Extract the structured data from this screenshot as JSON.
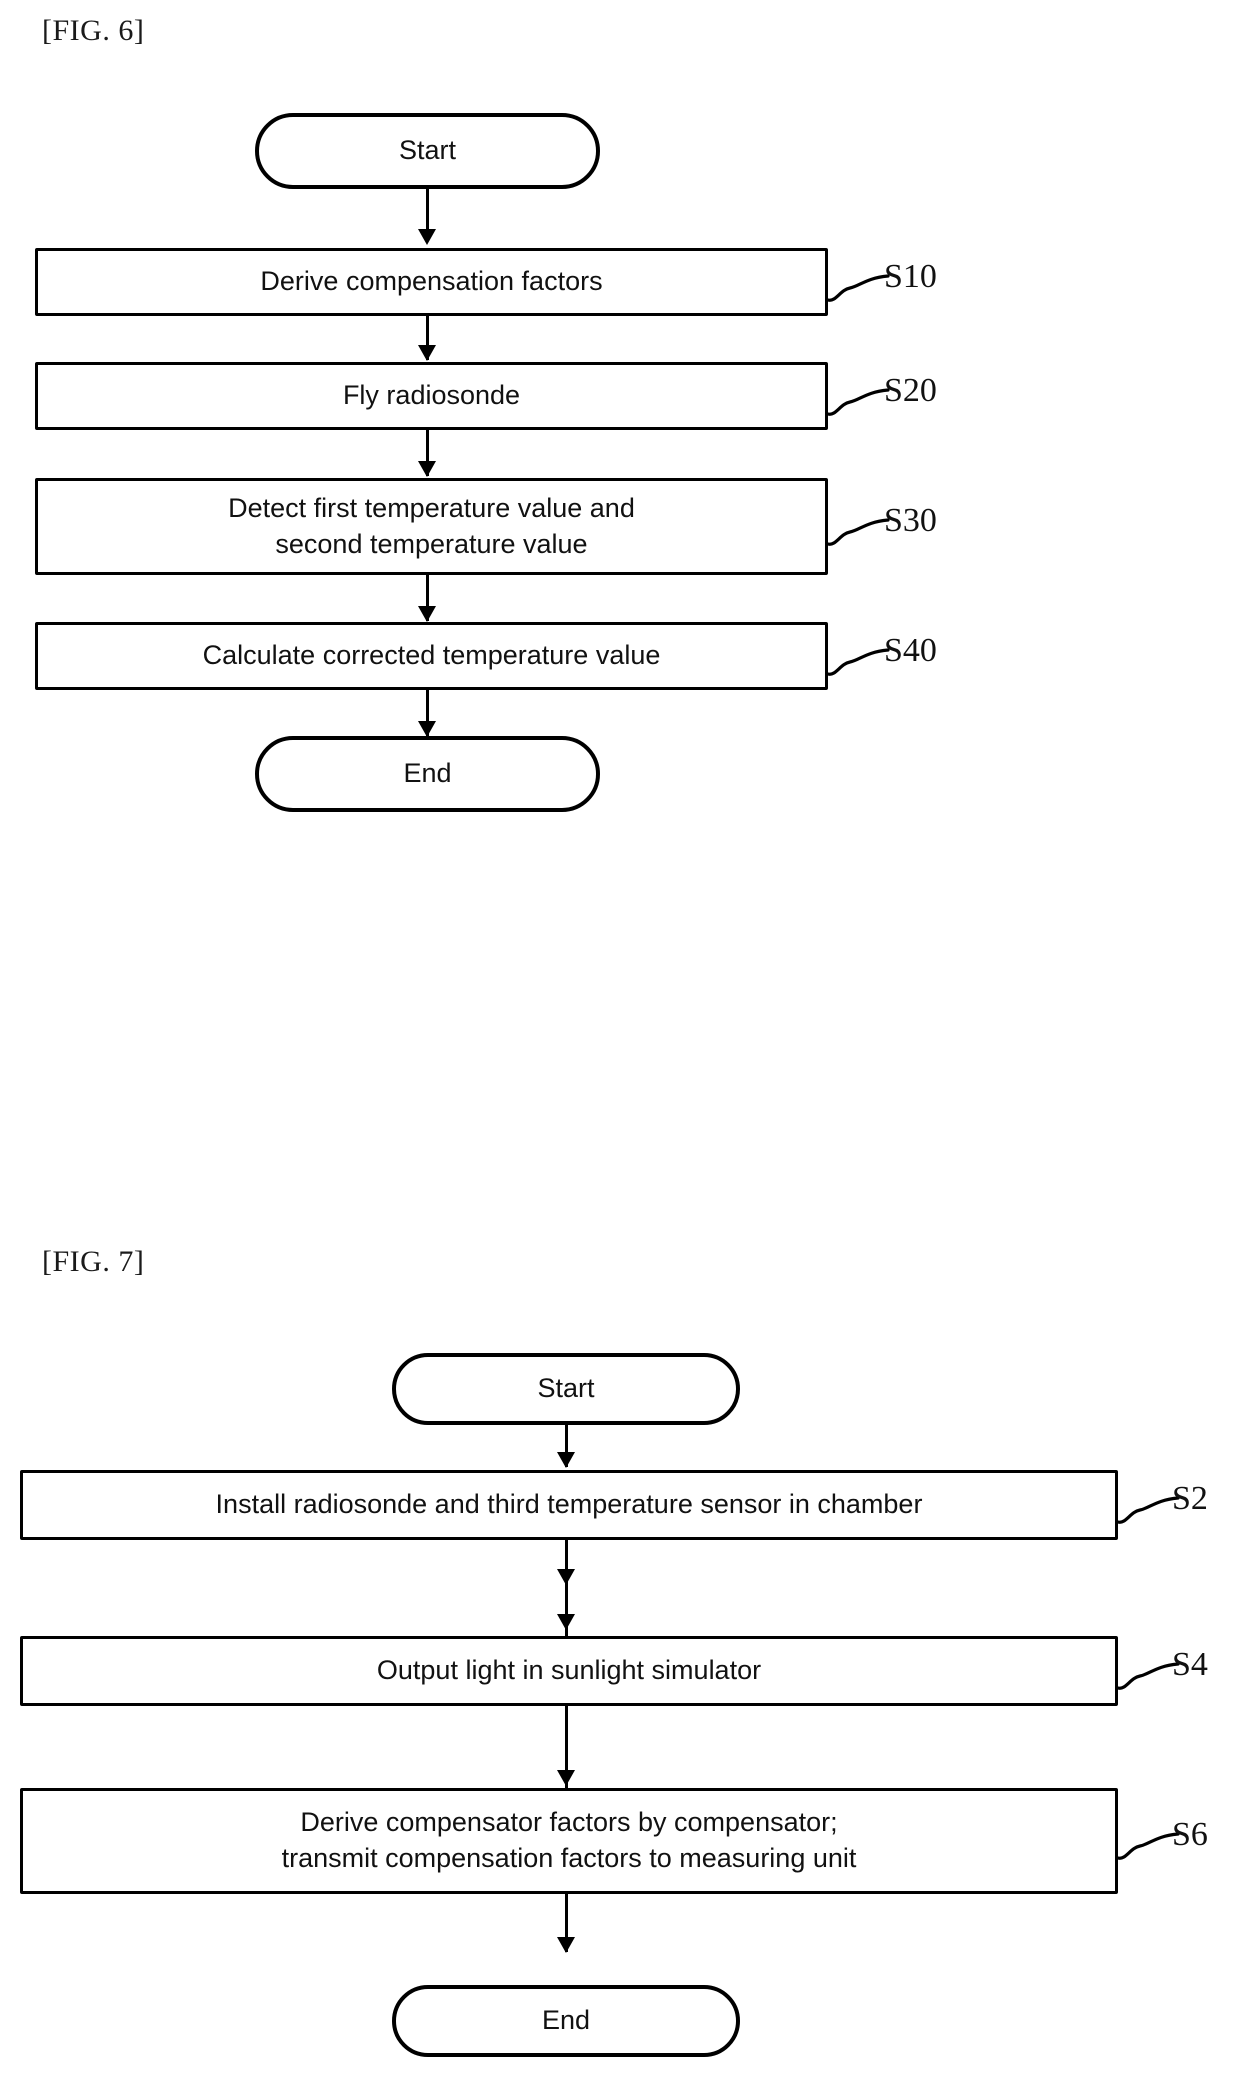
{
  "figures": [
    {
      "caption": "[FIG. 6]",
      "start_label": "Start",
      "end_label": "End",
      "steps": [
        {
          "text": "Derive compensation factors",
          "ref": "S10"
        },
        {
          "text": "Fly radiosonde",
          "ref": "S20"
        },
        {
          "text": "Detect first temperature value and\nsecond temperature value",
          "ref": "S30"
        },
        {
          "text": "Calculate corrected temperature value",
          "ref": "S40"
        }
      ]
    },
    {
      "caption": "[FIG. 7]",
      "start_label": "Start",
      "end_label": "End",
      "steps": [
        {
          "text": "Install radiosonde and third temperature sensor in chamber",
          "ref": "S2"
        },
        {
          "text": "Output light in sunlight simulator",
          "ref": "S4"
        },
        {
          "text": "Derive compensator factors by compensator;\ntransmit compensation factors to measuring unit",
          "ref": "S6"
        }
      ]
    }
  ],
  "colors": {
    "ink": "#000000",
    "paper": "#ffffff"
  }
}
